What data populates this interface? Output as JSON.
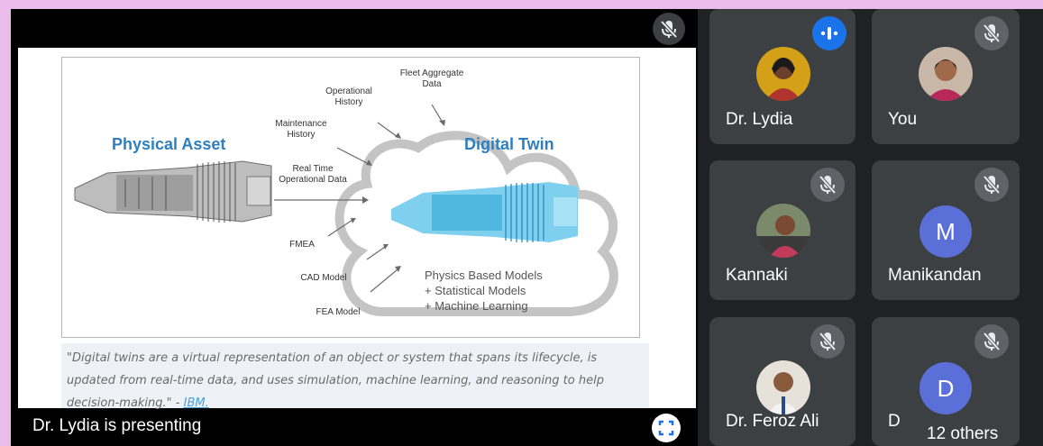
{
  "presentation": {
    "presenter_label": "Dr. Lydia is presenting",
    "slide": {
      "left_title": "Physical Asset",
      "right_title": "Digital Twin",
      "inputs": {
        "fleet": "Fleet Aggregate",
        "fleet2": "Data",
        "operational": "Operational",
        "history": "History",
        "maintenance": "Maintenance",
        "maint_history": "History",
        "realtime": "Real Time",
        "opdata": "Operational Data",
        "fmea": "FMEA",
        "cad": "CAD Model",
        "fea": "FEA Model"
      },
      "models": [
        "Physics Based Models",
        "+ Statistical Models",
        "+ Machine Learning"
      ],
      "quote": "\"Digital twins are a virtual representation of an object or system that spans its lifecycle, is updated from real-time data, and uses simulation, machine learning, and reasoning to help decision-making.\" - ",
      "quote_source": "IBM."
    }
  },
  "participants": [
    {
      "name": "Dr. Lydia",
      "status": "speaking"
    },
    {
      "name": "You",
      "status": "muted"
    },
    {
      "name": "Kannaki",
      "status": "muted"
    },
    {
      "name": "Manikandan",
      "status": "muted",
      "initial": "M"
    },
    {
      "name": "Dr. Feroz Ali",
      "status": "muted"
    },
    {
      "name": "D",
      "status": "muted",
      "initial": "D"
    }
  ],
  "others_label": "12 others",
  "colors": {
    "accent_blue": "#1a73e8",
    "slide_title": "#2e7fbf",
    "avatar_purple": "#5b6fd8"
  }
}
